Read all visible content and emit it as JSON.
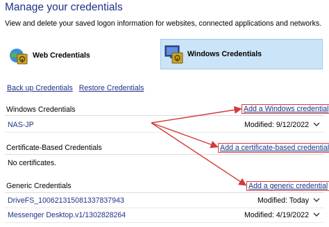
{
  "header": {
    "title": "Manage your credentials",
    "description": "View and delete your saved logon information for websites, connected applications and networks."
  },
  "credential_types": {
    "web_label": "Web Credentials",
    "windows_label": "Windows Credentials",
    "selected": "Windows Credentials"
  },
  "links": {
    "backup": "Back up Credentials",
    "restore": "Restore Credentials"
  },
  "sections": {
    "windows": {
      "heading": "Windows Credentials",
      "action": "Add a Windows credential",
      "items": [
        {
          "name": "NAS-JP",
          "modified": "Modified:  9/12/2022"
        }
      ]
    },
    "certificate": {
      "heading": "Certificate-Based Credentials",
      "action": "Add a certificate-based credential",
      "empty_text": "No certificates."
    },
    "generic": {
      "heading": "Generic Credentials",
      "action": "Add a generic credential",
      "items": [
        {
          "name": "DriveFS_100621315081337837943",
          "modified": "Modified:  Today"
        },
        {
          "name": "Messenger Desktop.v1/1302828264",
          "modified": "Modified:  4/19/2022"
        }
      ]
    }
  },
  "colors": {
    "link": "#1e3287",
    "selected_bg": "#cce4f7",
    "annotation_red": "#d43a3a"
  },
  "icons": [
    "web-credentials-icon",
    "windows-credentials-icon",
    "chevron-down-icon"
  ]
}
